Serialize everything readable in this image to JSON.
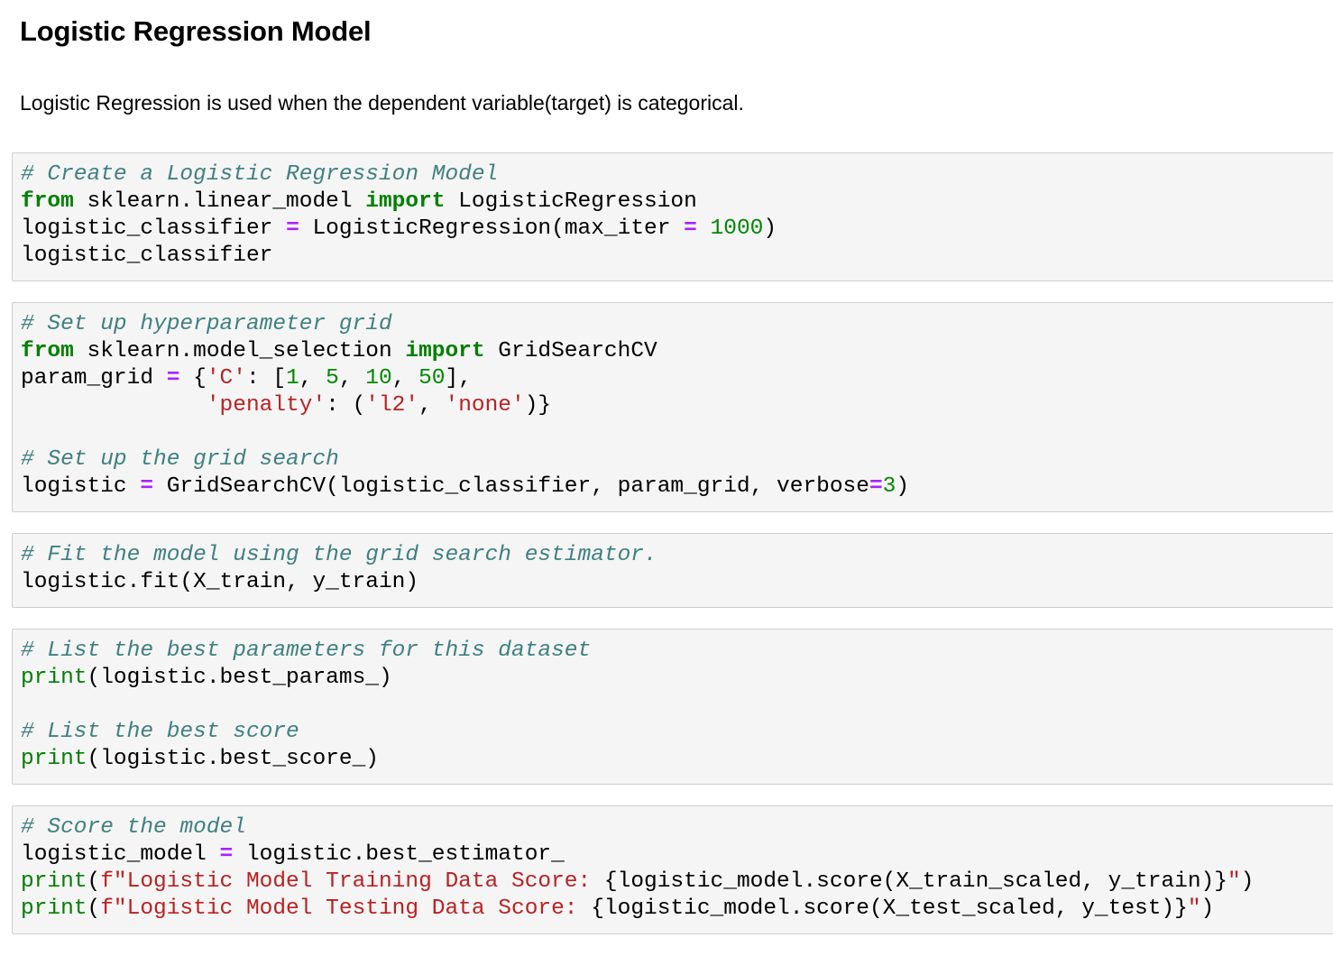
{
  "markdown": {
    "heading": "Logistic Regression Model",
    "text": "Logistic Regression is used when the dependent variable(target) is categorical."
  },
  "cells": [
    {
      "lines": [
        [
          {
            "t": "c",
            "v": "# Create a Logistic Regression Model"
          }
        ],
        [
          {
            "t": "k",
            "v": "from"
          },
          {
            "t": "p",
            "v": " sklearn.linear_model "
          },
          {
            "t": "k",
            "v": "import"
          },
          {
            "t": "p",
            "v": " LogisticRegression"
          }
        ],
        [
          {
            "t": "p",
            "v": "logistic_classifier "
          },
          {
            "t": "o",
            "v": "="
          },
          {
            "t": "p",
            "v": " LogisticRegression(max_iter "
          },
          {
            "t": "o",
            "v": "="
          },
          {
            "t": "p",
            "v": " "
          },
          {
            "t": "n",
            "v": "1000"
          },
          {
            "t": "p",
            "v": ")"
          }
        ],
        [
          {
            "t": "p",
            "v": "logistic_classifier"
          }
        ]
      ]
    },
    {
      "lines": [
        [
          {
            "t": "c",
            "v": "# Set up hyperparameter grid"
          }
        ],
        [
          {
            "t": "k",
            "v": "from"
          },
          {
            "t": "p",
            "v": " sklearn.model_selection "
          },
          {
            "t": "k",
            "v": "import"
          },
          {
            "t": "p",
            "v": " GridSearchCV"
          }
        ],
        [
          {
            "t": "p",
            "v": "param_grid "
          },
          {
            "t": "o",
            "v": "="
          },
          {
            "t": "p",
            "v": " {"
          },
          {
            "t": "s",
            "v": "'C'"
          },
          {
            "t": "p",
            "v": ": ["
          },
          {
            "t": "n",
            "v": "1"
          },
          {
            "t": "p",
            "v": ", "
          },
          {
            "t": "n",
            "v": "5"
          },
          {
            "t": "p",
            "v": ", "
          },
          {
            "t": "n",
            "v": "10"
          },
          {
            "t": "p",
            "v": ", "
          },
          {
            "t": "n",
            "v": "50"
          },
          {
            "t": "p",
            "v": "],"
          }
        ],
        [
          {
            "t": "p",
            "v": "              "
          },
          {
            "t": "s",
            "v": "'penalty'"
          },
          {
            "t": "p",
            "v": ": ("
          },
          {
            "t": "s",
            "v": "'l2'"
          },
          {
            "t": "p",
            "v": ", "
          },
          {
            "t": "s",
            "v": "'none'"
          },
          {
            "t": "p",
            "v": ")}"
          }
        ],
        [],
        [
          {
            "t": "c",
            "v": "# Set up the grid search"
          }
        ],
        [
          {
            "t": "p",
            "v": "logistic "
          },
          {
            "t": "o",
            "v": "="
          },
          {
            "t": "p",
            "v": " GridSearchCV(logistic_classifier, param_grid, verbose"
          },
          {
            "t": "o",
            "v": "="
          },
          {
            "t": "n",
            "v": "3"
          },
          {
            "t": "p",
            "v": ")"
          }
        ]
      ]
    },
    {
      "lines": [
        [
          {
            "t": "c",
            "v": "# Fit the model using the grid search estimator."
          }
        ],
        [
          {
            "t": "p",
            "v": "logistic.fit(X_train, y_train)"
          }
        ]
      ]
    },
    {
      "lines": [
        [
          {
            "t": "c",
            "v": "# List the best parameters for this dataset"
          }
        ],
        [
          {
            "t": "bi",
            "v": "print"
          },
          {
            "t": "p",
            "v": "(logistic.best_params_)"
          }
        ],
        [],
        [
          {
            "t": "c",
            "v": "# List the best score"
          }
        ],
        [
          {
            "t": "bi",
            "v": "print"
          },
          {
            "t": "p",
            "v": "(logistic.best_score_)"
          }
        ]
      ]
    },
    {
      "lines": [
        [
          {
            "t": "c",
            "v": "# Score the model"
          }
        ],
        [
          {
            "t": "p",
            "v": "logistic_model "
          },
          {
            "t": "o",
            "v": "="
          },
          {
            "t": "p",
            "v": " logistic.best_estimator_"
          }
        ],
        [
          {
            "t": "bi",
            "v": "print"
          },
          {
            "t": "p",
            "v": "("
          },
          {
            "t": "s",
            "v": "f\"Logistic Model Training Data Score: "
          },
          {
            "t": "si",
            "v": "{logistic_model.score(X_train_scaled, y_train)}"
          },
          {
            "t": "s",
            "v": "\""
          },
          {
            "t": "p",
            "v": ")"
          }
        ],
        [
          {
            "t": "bi",
            "v": "print"
          },
          {
            "t": "p",
            "v": "("
          },
          {
            "t": "s",
            "v": "f\"Logistic Model Testing Data Score: "
          },
          {
            "t": "si",
            "v": "{logistic_model.score(X_test_scaled, y_test)}"
          },
          {
            "t": "s",
            "v": "\""
          },
          {
            "t": "p",
            "v": ")"
          }
        ]
      ]
    }
  ]
}
